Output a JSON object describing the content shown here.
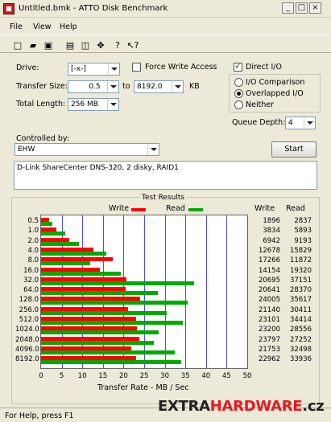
{
  "window": {
    "title": "Untitled.bmk - ATTO Disk Benchmark",
    "controls": [
      "_",
      "□",
      "×"
    ]
  },
  "menu": [
    "File",
    "View",
    "Help"
  ],
  "toolbar_icons": [
    "new-icon",
    "open-icon",
    "save-icon",
    "print-icon",
    "preview-icon",
    "move-icon",
    "help-icon",
    "context-help-icon"
  ],
  "toolbar_glyphs": [
    "□",
    "▰",
    "▣",
    "▤",
    "◫",
    "✥",
    "?",
    "↖?"
  ],
  "settings": {
    "drive_label": "Drive:",
    "drive_value": "[-x-]",
    "force_write_label": "Force Write Access",
    "direct_io_label": "Direct I/O",
    "direct_io_checked": true,
    "transfer_size_label": "Transfer Size:",
    "transfer_from": "0.5",
    "to_label": "to",
    "transfer_to": "8192.0",
    "unit": "KB",
    "total_length_label": "Total Length:",
    "total_length": "256 MB",
    "io_modes": [
      "I/O Comparison",
      "Overlapped I/O",
      "Neither"
    ],
    "selected_io_mode": "Overlapped I/O",
    "queue_depth_label": "Queue Depth:",
    "queue_depth": "4",
    "controlled_by_label": "Controlled by:",
    "controlled_by": "EHW",
    "start_label": "Start",
    "description": "D-Link ShareCenter DNS-320, 2 disky, RAID1"
  },
  "chart_data": {
    "type": "bar",
    "title": "Test Results",
    "xlabel": "Transfer Rate - MB / Sec",
    "ylabel": "",
    "orientation": "horizontal",
    "xlim": [
      0,
      50
    ],
    "x_ticks": [
      "0",
      "5",
      "10",
      "15",
      "20",
      "25",
      "30",
      "35",
      "40",
      "45",
      "50"
    ],
    "categories": [
      "0.5",
      "1.0",
      "2.0",
      "4.0",
      "8.0",
      "16.0",
      "32.0",
      "64.0",
      "128.0",
      "256.0",
      "512.0",
      "1024.0",
      "2048.0",
      "4096.0",
      "8192.0"
    ],
    "series": [
      {
        "name": "Write",
        "color": "#ff0000",
        "values": [
          1.9,
          3.8,
          6.9,
          12.7,
          17.3,
          14.2,
          20.7,
          20.6,
          24.0,
          21.1,
          23.1,
          23.2,
          23.8,
          21.8,
          23.0
        ]
      },
      {
        "name": "Read",
        "color": "#00aa00",
        "values": [
          2.8,
          5.9,
          9.2,
          15.8,
          11.9,
          19.3,
          37.2,
          28.4,
          35.6,
          30.4,
          34.4,
          28.6,
          27.3,
          32.5,
          33.9
        ]
      }
    ],
    "table_headers": [
      "Write",
      "Read"
    ],
    "table_values": [
      [
        "1896",
        "2837"
      ],
      [
        "3834",
        "5893"
      ],
      [
        "6942",
        "9193"
      ],
      [
        "12678",
        "15829"
      ],
      [
        "17266",
        "11872"
      ],
      [
        "14154",
        "19320"
      ],
      [
        "20695",
        "37151"
      ],
      [
        "20641",
        "28370"
      ],
      [
        "24005",
        "35617"
      ],
      [
        "21140",
        "30411"
      ],
      [
        "23101",
        "34414"
      ],
      [
        "23200",
        "28556"
      ],
      [
        "23797",
        "27252"
      ],
      [
        "21753",
        "32498"
      ],
      [
        "22962",
        "33936"
      ]
    ],
    "grid": true,
    "legend": "top"
  },
  "status": "For Help, press F1",
  "watermark": {
    "part1": "EXTRA",
    "part2": "HARDWARE",
    "part3": ".cz"
  }
}
